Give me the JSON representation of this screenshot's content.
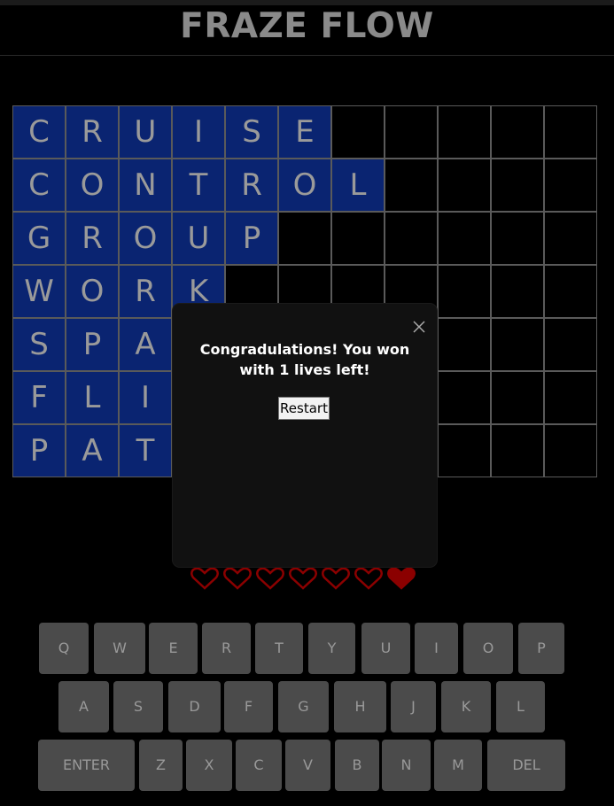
{
  "app_title": "FRAZE FLOW",
  "board": {
    "rows": [
      [
        "C",
        "R",
        "U",
        "I",
        "S",
        "E",
        "",
        "",
        "",
        "",
        ""
      ],
      [
        "C",
        "O",
        "N",
        "T",
        "R",
        "O",
        "L",
        "",
        "",
        "",
        ""
      ],
      [
        "G",
        "R",
        "O",
        "U",
        "P",
        "",
        "",
        "",
        "",
        "",
        ""
      ],
      [
        "W",
        "O",
        "R",
        "K",
        "",
        "",
        "",
        "",
        "",
        "",
        ""
      ],
      [
        "S",
        "P",
        "A",
        "",
        "",
        "",
        "",
        "",
        "",
        "",
        ""
      ],
      [
        "F",
        "L",
        "I",
        "",
        "",
        "",
        "",
        "",
        "",
        "",
        ""
      ],
      [
        "P",
        "A",
        "T",
        "",
        "",
        "",
        "",
        "",
        "",
        "",
        ""
      ]
    ]
  },
  "lives": {
    "total": 7,
    "remaining": 1,
    "icon": "heart-icon"
  },
  "keyboard": {
    "row1": [
      "Q",
      "W",
      "E",
      "R",
      "T",
      "Y",
      "U",
      "I",
      "O",
      "P"
    ],
    "row2": [
      "A",
      "S",
      "D",
      "F",
      "G",
      "H",
      "J",
      "K",
      "L"
    ],
    "row3": [
      "ENTER",
      "Z",
      "X",
      "C",
      "V",
      "B",
      "N",
      "M",
      "DEL"
    ]
  },
  "modal": {
    "message": "Congradulations! You won with 1 lives left!",
    "restart_label": "Restart",
    "close_icon": "close-icon"
  },
  "colors": {
    "filled_cell": "#0a2471",
    "heart": "#8b0000",
    "key": "#4b4b4b",
    "title": "#8a8a8a"
  }
}
